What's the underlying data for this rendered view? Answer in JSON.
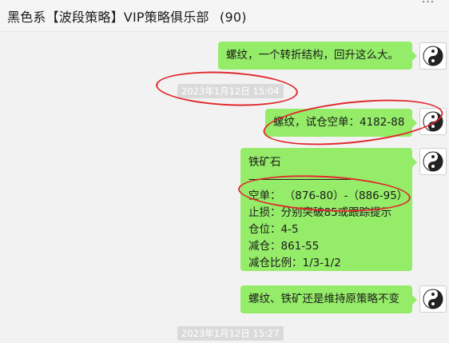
{
  "chat": {
    "title": "黑色系【波段策略】VIP策略俱乐部",
    "member_count": "(90)"
  },
  "messages": [
    {
      "text": "螺纹，一个转折结构，回升这么大。"
    },
    {
      "text": "螺纹，试仓空单：4182-88"
    },
    {
      "lines": [
        "铁矿石",
        "---------------------------------",
        "空单： （876-80）-（886-95）",
        "止损：分别突破85或跟踪提示",
        "仓位：4-5",
        "减仓：861-55",
        "减仓比例：1/3-1/2"
      ]
    },
    {
      "text": "螺纹、铁矿还是维持原策略不变"
    }
  ],
  "timestamps": [
    "2023年1月12日 15:04",
    "2023年1月12日 15:27"
  ],
  "icons": {
    "avatar": "yin-yang-icon",
    "menu": "more-options-icon"
  },
  "colors": {
    "bubble": "#95ec69",
    "annotation": "#e0292c",
    "background": "#f2f2f2"
  }
}
